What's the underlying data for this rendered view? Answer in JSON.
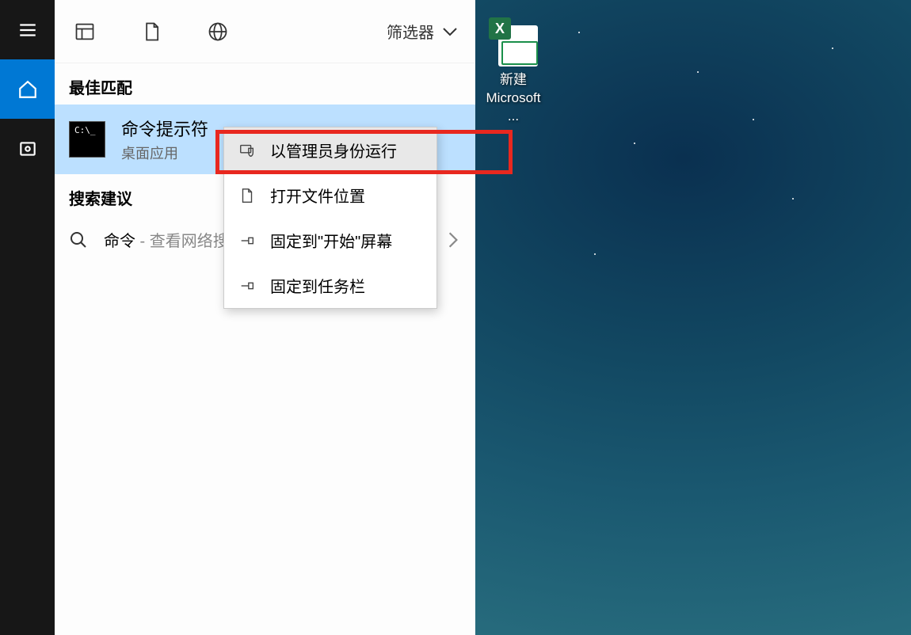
{
  "sidebar": {
    "menu": "menu",
    "home": "home",
    "settings": "settings"
  },
  "tabs": {
    "apps": "apps",
    "documents": "documents",
    "web": "web"
  },
  "filter_label": "筛选器",
  "sections": {
    "best_match": "最佳匹配",
    "search_suggestions": "搜索建议"
  },
  "result": {
    "title": "命令提示符",
    "subtitle": "桌面应用",
    "cmd_prompt": "C:\\_"
  },
  "suggestion": {
    "term": "命令",
    "hint": " - 查看网络搜"
  },
  "context_menu": {
    "items": [
      {
        "label": "以管理员身份运行",
        "highlighted": true
      },
      {
        "label": "打开文件位置",
        "highlighted": false
      },
      {
        "label": "固定到\"开始\"屏幕",
        "highlighted": false
      },
      {
        "label": "固定到任务栏",
        "highlighted": false
      }
    ]
  },
  "desktop": {
    "icon": {
      "badge": "X",
      "label_line1": "新建",
      "label_line2": "Microsoft ..."
    }
  }
}
